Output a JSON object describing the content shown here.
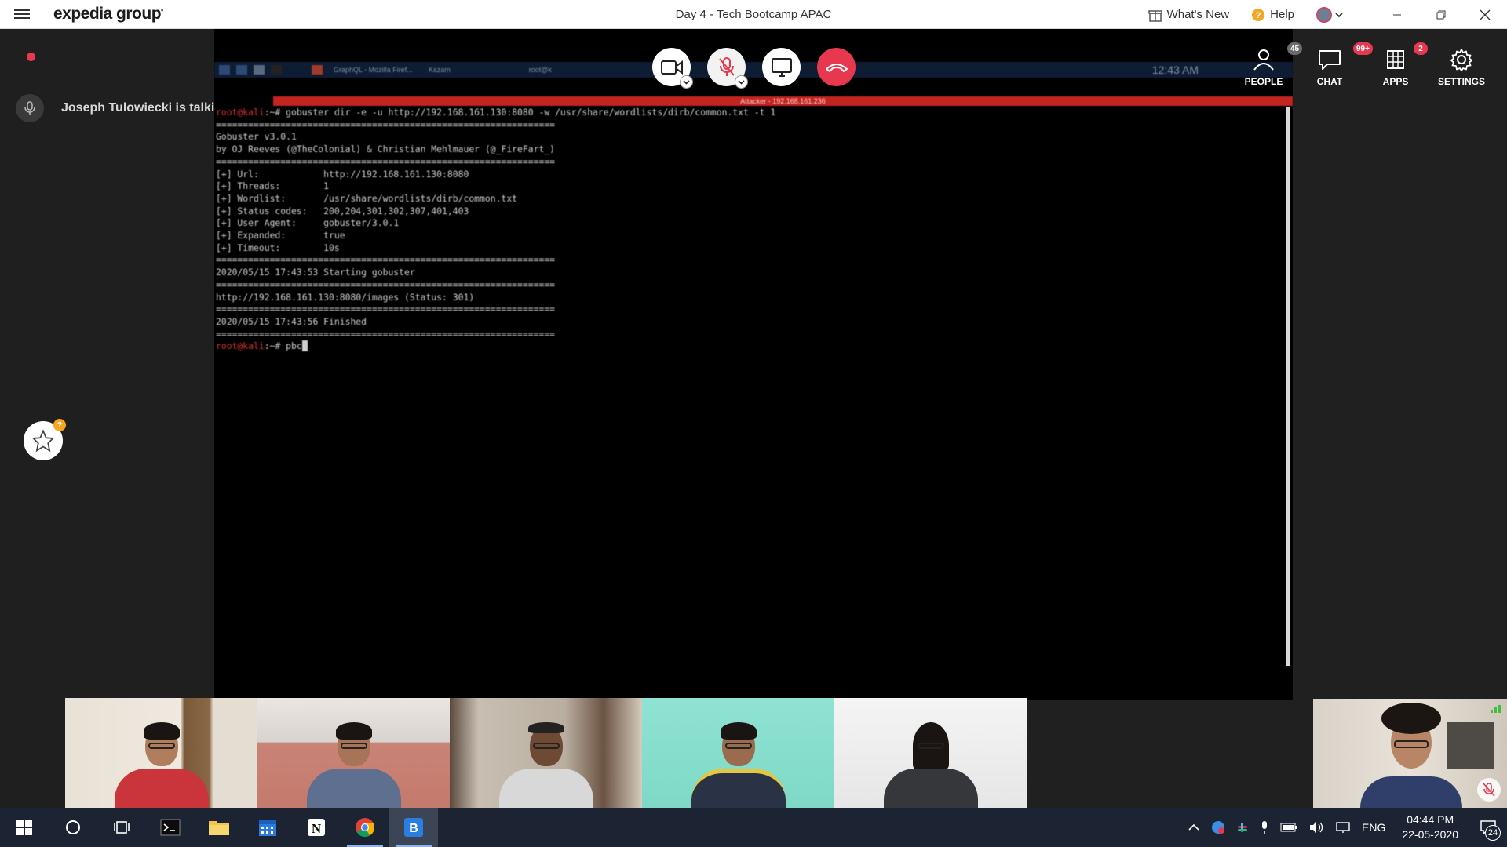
{
  "window": {
    "brand": "expedia group",
    "title": "Day 4 - Tech Bootcamp APAC",
    "whats_new": "What's New",
    "help": "Help"
  },
  "sidebar": {
    "talking_text": "Joseph Tulowiecki is talking",
    "favorites_badge": "?"
  },
  "call_controls": {
    "camera": "camera-button",
    "mute": "mute-button",
    "share": "share-screen-button",
    "hangup": "hang-up-button"
  },
  "right_nav": {
    "people": {
      "label": "PEOPLE",
      "badge": "45"
    },
    "chat": {
      "label": "CHAT",
      "badge": "99+"
    },
    "apps": {
      "label": "APPS",
      "badge": "2"
    },
    "settings": {
      "label": "SETTINGS"
    }
  },
  "shared_screen": {
    "kali_taskbar": {
      "tab1": "GraphQL - Mozilla Firef...",
      "tab2": "Kazam",
      "tab3": "root@k",
      "clock": "12:43 AM"
    },
    "attacker_bar": "Attacker - 192.168.161.236",
    "terminal_lines": {
      "l1_prompt": "root@kali",
      "l1_cmd": ":~# gobuster dir -e -u http://192.168.161.130:8080 -w /usr/share/wordlists/dirb/common.txt -t 1",
      "l2": "===============================================================",
      "l3": "Gobuster v3.0.1",
      "l4": "by OJ Reeves (@TheColonial) & Christian Mehlmauer (@_FireFart_)",
      "l5": "===============================================================",
      "l6": "[+] Url:            http://192.168.161.130:8080",
      "l7": "[+] Threads:        1",
      "l8": "[+] Wordlist:       /usr/share/wordlists/dirb/common.txt",
      "l9": "[+] Status codes:   200,204,301,302,307,401,403",
      "l10": "[+] User Agent:     gobuster/3.0.1",
      "l11": "[+] Expanded:       true",
      "l12": "[+] Timeout:        10s",
      "l13": "===============================================================",
      "l14": "2020/05/15 17:43:53 Starting gobuster",
      "l15": "===============================================================",
      "l16": "http://192.168.161.130:8080/images (Status: 301)",
      "l17": "===============================================================",
      "l18": "2020/05/15 17:43:56 Finished",
      "l19": "===============================================================",
      "l20_prompt": "root@kali",
      "l20_cmd": ":~# pbc"
    }
  },
  "taskbar": {
    "lang": "ENG",
    "time": "04:44 PM",
    "date": "22-05-2020",
    "notifications": "24"
  }
}
